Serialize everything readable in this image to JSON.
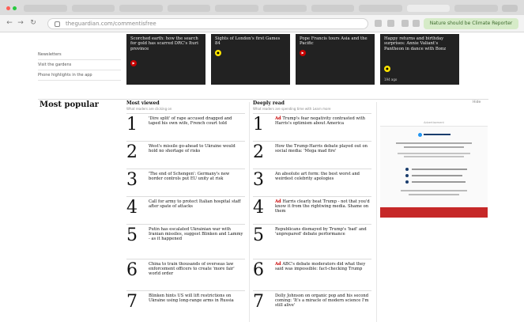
{
  "browser": {
    "url": "theguardian.com/commentisfree",
    "extension_label": "Nature should be Climate Reporter"
  },
  "sidebar": {
    "links": [
      "Newsletters",
      "Visit the gardens",
      "Phone highlights in the app"
    ]
  },
  "cards": [
    {
      "title": "Scorched earth: how the search for gold has scarred DRC's Ituri province",
      "badge": "red"
    },
    {
      "title": "Sights of London's first Games 84",
      "badge": "yellow"
    },
    {
      "title": "Pope Francis tours Asia and the Pacific",
      "badge": "red"
    },
    {
      "title": "Happy returns and birthday surprises: Annie Valiant's Pantheon in dance with Bonz",
      "badge": "yellow",
      "foot": "194 ago"
    }
  ],
  "most_popular": {
    "title": "Most popular",
    "hide_label": "Hide",
    "most_viewed": {
      "heading": "Most viewed",
      "subheading": "What readers are clicking on",
      "items": [
        {
          "num": "1",
          "text": "'Dire split' of rape accused dragged and taped his own wife, French court told"
        },
        {
          "num": "2",
          "text": "West's missile go-ahead to Ukraine would hold no shortage of risks"
        },
        {
          "num": "3",
          "text": "'The end of Schengen': Germany's new border controls put EU unity at risk"
        },
        {
          "num": "4",
          "text": "Call for army to protect Italian hospital staff after spate of attacks"
        },
        {
          "num": "5",
          "text": "Putin has escalated Ukrainian war with Iranian missiles, suggest Blinken and Lammy - as it happened"
        },
        {
          "num": "6",
          "text": "China to train thousands of overseas law enforcement officers to create 'more fair' world order"
        },
        {
          "num": "7",
          "text": "Blinken hints US will lift restrictions on Ukraine using long-range arms in Russia"
        }
      ]
    },
    "deeply_read": {
      "heading": "Deeply read",
      "subheading": "What readers are spending time with",
      "learn_more": "Learn more",
      "items": [
        {
          "num": "1",
          "kicker": "Ad",
          "text": "Trump's fear negativity contrasted with Harris's optimism about America"
        },
        {
          "num": "2",
          "kicker": "",
          "text": "How the Trump-Harris debate played out on social media: 'Mega mad fire'"
        },
        {
          "num": "3",
          "kicker": "",
          "text": "An absolute art form: the best worst and weirdest celebrity apologies"
        },
        {
          "num": "4",
          "kicker": "Ad",
          "text": "Harris clearly beat Trump - not that you'd know it from the rightwing media. Shame on them"
        },
        {
          "num": "5",
          "kicker": "",
          "text": "Republicans dismayed by Trump's 'bad' and 'unprepared' debate performance"
        },
        {
          "num": "6",
          "kicker": "Ad",
          "text": "ABC's debate moderators did what they said was impossible: fact-checking Trump"
        },
        {
          "num": "7",
          "kicker": "",
          "text": "Dolly Johnson on organic pop and his second coming: 'It's a miracle of modern science I'm still alive'"
        }
      ]
    }
  },
  "ad": {
    "label": "Advertisement",
    "button": ""
  },
  "colors": {
    "guardian_red": "#c70000",
    "card_bg": "#222222",
    "badge_yellow": "#ffe500",
    "extension_green": "#d6ebc8"
  }
}
